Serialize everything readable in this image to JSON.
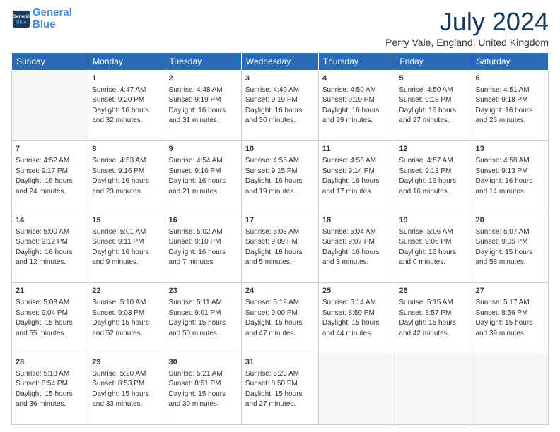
{
  "header": {
    "logo_line1": "General",
    "logo_line2": "Blue",
    "month_title": "July 2024",
    "location": "Perry Vale, England, United Kingdom"
  },
  "weekdays": [
    "Sunday",
    "Monday",
    "Tuesday",
    "Wednesday",
    "Thursday",
    "Friday",
    "Saturday"
  ],
  "weeks": [
    [
      {
        "num": "",
        "empty": true
      },
      {
        "num": "1",
        "sunrise": "4:47 AM",
        "sunset": "9:20 PM",
        "daylight": "16 hours and 32 minutes."
      },
      {
        "num": "2",
        "sunrise": "4:48 AM",
        "sunset": "9:19 PM",
        "daylight": "16 hours and 31 minutes."
      },
      {
        "num": "3",
        "sunrise": "4:49 AM",
        "sunset": "9:19 PM",
        "daylight": "16 hours and 30 minutes."
      },
      {
        "num": "4",
        "sunrise": "4:50 AM",
        "sunset": "9:19 PM",
        "daylight": "16 hours and 29 minutes."
      },
      {
        "num": "5",
        "sunrise": "4:50 AM",
        "sunset": "9:18 PM",
        "daylight": "16 hours and 27 minutes."
      },
      {
        "num": "6",
        "sunrise": "4:51 AM",
        "sunset": "9:18 PM",
        "daylight": "16 hours and 26 minutes."
      }
    ],
    [
      {
        "num": "7",
        "sunrise": "4:52 AM",
        "sunset": "9:17 PM",
        "daylight": "16 hours and 24 minutes."
      },
      {
        "num": "8",
        "sunrise": "4:53 AM",
        "sunset": "9:16 PM",
        "daylight": "16 hours and 23 minutes."
      },
      {
        "num": "9",
        "sunrise": "4:54 AM",
        "sunset": "9:16 PM",
        "daylight": "16 hours and 21 minutes."
      },
      {
        "num": "10",
        "sunrise": "4:55 AM",
        "sunset": "9:15 PM",
        "daylight": "16 hours and 19 minutes."
      },
      {
        "num": "11",
        "sunrise": "4:56 AM",
        "sunset": "9:14 PM",
        "daylight": "16 hours and 17 minutes."
      },
      {
        "num": "12",
        "sunrise": "4:57 AM",
        "sunset": "9:13 PM",
        "daylight": "16 hours and 16 minutes."
      },
      {
        "num": "13",
        "sunrise": "4:58 AM",
        "sunset": "9:13 PM",
        "daylight": "16 hours and 14 minutes."
      }
    ],
    [
      {
        "num": "14",
        "sunrise": "5:00 AM",
        "sunset": "9:12 PM",
        "daylight": "16 hours and 12 minutes."
      },
      {
        "num": "15",
        "sunrise": "5:01 AM",
        "sunset": "9:11 PM",
        "daylight": "16 hours and 9 minutes."
      },
      {
        "num": "16",
        "sunrise": "5:02 AM",
        "sunset": "9:10 PM",
        "daylight": "16 hours and 7 minutes."
      },
      {
        "num": "17",
        "sunrise": "5:03 AM",
        "sunset": "9:09 PM",
        "daylight": "16 hours and 5 minutes."
      },
      {
        "num": "18",
        "sunrise": "5:04 AM",
        "sunset": "9:07 PM",
        "daylight": "16 hours and 3 minutes."
      },
      {
        "num": "19",
        "sunrise": "5:06 AM",
        "sunset": "9:06 PM",
        "daylight": "16 hours and 0 minutes."
      },
      {
        "num": "20",
        "sunrise": "5:07 AM",
        "sunset": "9:05 PM",
        "daylight": "15 hours and 58 minutes."
      }
    ],
    [
      {
        "num": "21",
        "sunrise": "5:08 AM",
        "sunset": "9:04 PM",
        "daylight": "15 hours and 55 minutes."
      },
      {
        "num": "22",
        "sunrise": "5:10 AM",
        "sunset": "9:03 PM",
        "daylight": "15 hours and 52 minutes."
      },
      {
        "num": "23",
        "sunrise": "5:11 AM",
        "sunset": "9:01 PM",
        "daylight": "15 hours and 50 minutes."
      },
      {
        "num": "24",
        "sunrise": "5:12 AM",
        "sunset": "9:00 PM",
        "daylight": "15 hours and 47 minutes."
      },
      {
        "num": "25",
        "sunrise": "5:14 AM",
        "sunset": "8:59 PM",
        "daylight": "15 hours and 44 minutes."
      },
      {
        "num": "26",
        "sunrise": "5:15 AM",
        "sunset": "8:57 PM",
        "daylight": "15 hours and 42 minutes."
      },
      {
        "num": "27",
        "sunrise": "5:17 AM",
        "sunset": "8:56 PM",
        "daylight": "15 hours and 39 minutes."
      }
    ],
    [
      {
        "num": "28",
        "sunrise": "5:18 AM",
        "sunset": "8:54 PM",
        "daylight": "15 hours and 36 minutes."
      },
      {
        "num": "29",
        "sunrise": "5:20 AM",
        "sunset": "8:53 PM",
        "daylight": "15 hours and 33 minutes."
      },
      {
        "num": "30",
        "sunrise": "5:21 AM",
        "sunset": "8:51 PM",
        "daylight": "15 hours and 30 minutes."
      },
      {
        "num": "31",
        "sunrise": "5:23 AM",
        "sunset": "8:50 PM",
        "daylight": "15 hours and 27 minutes."
      },
      {
        "num": "",
        "empty": true
      },
      {
        "num": "",
        "empty": true
      },
      {
        "num": "",
        "empty": true
      }
    ]
  ]
}
